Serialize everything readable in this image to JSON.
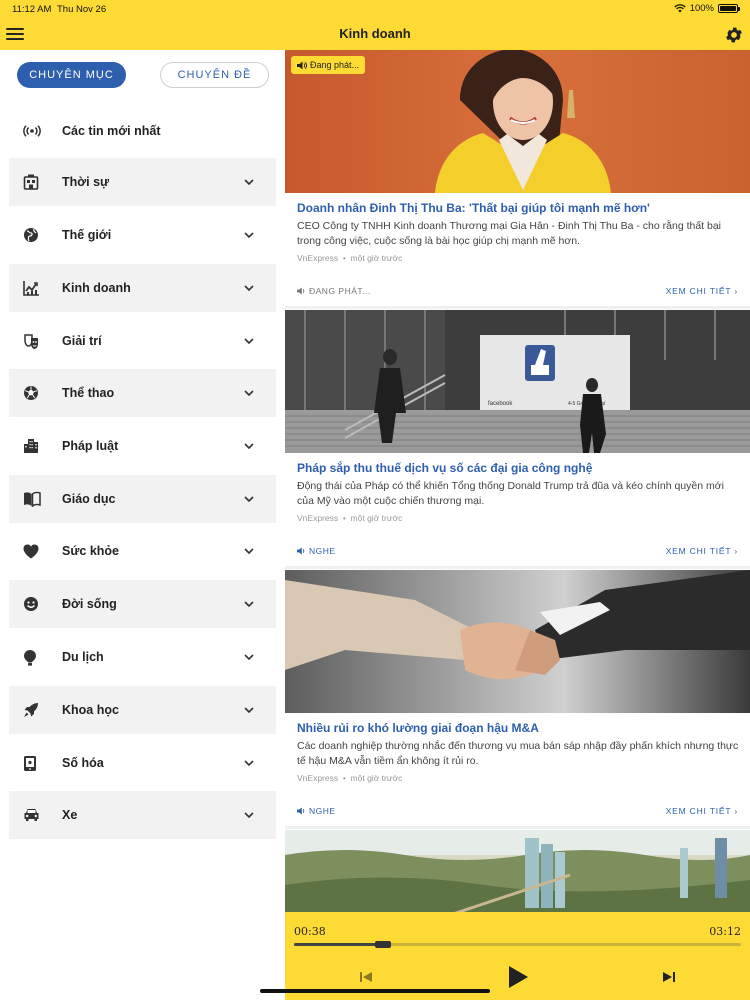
{
  "status": {
    "time": "11:12 AM",
    "date": "Thu Nov 26",
    "battery": "100%"
  },
  "nav": {
    "title": "Kinh doanh"
  },
  "sidebar": {
    "segments": {
      "active": "CHUYÊN MỤC",
      "inactive": "CHUYÊN ĐỀ"
    },
    "latest": "Các tin mới nhất",
    "items": [
      {
        "label": "Thời sự",
        "icon": "building-newspaper-icon"
      },
      {
        "label": "Thế giới",
        "icon": "globe-icon"
      },
      {
        "label": "Kinh doanh",
        "icon": "chart-trend-icon"
      },
      {
        "label": "Giải trí",
        "icon": "theater-mask-icon"
      },
      {
        "label": "Thể thao",
        "icon": "soccer-ball-icon"
      },
      {
        "label": "Pháp luật",
        "icon": "city-building-icon"
      },
      {
        "label": "Giáo dục",
        "icon": "open-book-icon"
      },
      {
        "label": "Sức khỏe",
        "icon": "heart-icon"
      },
      {
        "label": "Đời sống",
        "icon": "smiley-icon"
      },
      {
        "label": "Du lịch",
        "icon": "hot-air-balloon-icon"
      },
      {
        "label": "Khoa học",
        "icon": "rocket-icon"
      },
      {
        "label": "Số hóa",
        "icon": "tablet-device-icon"
      },
      {
        "label": "Xe",
        "icon": "car-icon"
      }
    ]
  },
  "feed": {
    "articles": [
      {
        "badge": "Đang phát...",
        "title": "Doanh nhân Đinh Thị Thu Ba: 'Thất bại giúp tôi mạnh mẽ hơn'",
        "summary": "CEO Công ty TNHH Kinh doanh Thương mại Gia Hân - Đinh Thị Thu Ba - cho rằng thất bại trong công việc, cuộc sống là bài học giúp chị mạnh mẽ hơn.",
        "source": "VnExpress",
        "time": "một giờ trước",
        "listen": "ĐANG PHÁT...",
        "more": "XEM CHI TIẾT"
      },
      {
        "title": "Pháp sắp thu thuế dịch vụ số các đại gia công nghệ",
        "summary": "Động thái của Pháp có thể khiến Tổng thống Donald Trump trả đũa và kéo chính quyền mới của Mỹ vào một cuộc chiến thương mại.",
        "source": "VnExpress",
        "time": "một giờ trước",
        "listen": "NGHE",
        "more": "XEM CHI TIẾT",
        "sign1": "facebook",
        "sign2": "4-5 Grand Canal"
      },
      {
        "title": "Nhiều rủi ro khó lường giai đoạn hậu M&A",
        "summary": "Các doanh nghiệp thường nhắc đến thương vụ mua bán sáp nhập đầy phấn khích nhưng thực tế hậu M&A vẫn tiềm ẩn không ít rủi ro.",
        "source": "VnExpress",
        "time": "một giờ trước",
        "listen": "NGHE",
        "more": "XEM CHI TIẾT"
      }
    ]
  },
  "player": {
    "elapsed": "00:38",
    "duration": "03:12",
    "progress": 0.2
  },
  "colors": {
    "accent_yellow": "#FEDB34",
    "brand_blue": "#2E5FAE",
    "row_grey": "#F2F2F2"
  }
}
